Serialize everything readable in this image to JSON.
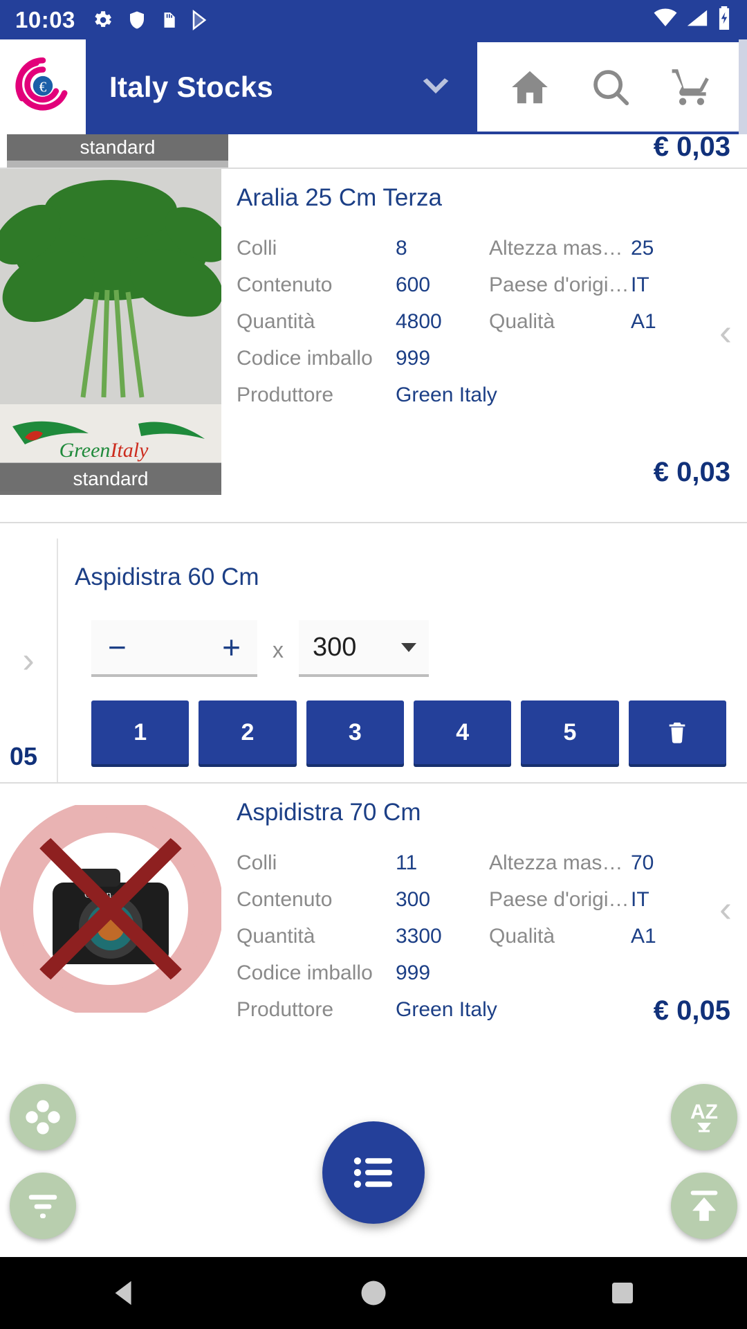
{
  "status_bar": {
    "time": "10:03",
    "left_icons": [
      "gear-icon",
      "shield-icon",
      "sd-card-icon",
      "play-store-icon"
    ],
    "right_icons": [
      "wifi-icon",
      "signal-icon",
      "battery-charging-icon"
    ]
  },
  "app_bar": {
    "logo": "company-rose-logo",
    "title": "Italy Stocks",
    "dropdown_icon": "chevron-down-icon",
    "actions": [
      {
        "name": "home-icon",
        "label": "Home"
      },
      {
        "name": "search-icon",
        "label": "Search"
      },
      {
        "name": "cart-icon",
        "label": "Cart"
      }
    ]
  },
  "colors": {
    "primary": "#24409a",
    "title_text": "#1c3f86",
    "price_text": "#11317a",
    "label_gray": "#8a8a8a",
    "fab_green": "#b8ceae",
    "badge_gray": "#5a5a5a"
  },
  "attribute_labels": {
    "colli": "Colli",
    "contenuto": "Contenuto",
    "quantita": "Quantità",
    "codice_imballo": "Codice imballo",
    "produttore": "Produttore",
    "altezza": "Altezza massi…",
    "paese": "Paese d'origine",
    "qualita": "Qualità"
  },
  "clipped_card": {
    "badge": "standard",
    "price": "€ 0,03"
  },
  "products": [
    {
      "name": "Aralia 25 Cm Terza",
      "image": "aralia-plant-photo",
      "image_badge": "standard",
      "colli": "8",
      "contenuto": "600",
      "quantita": "4800",
      "codice_imballo": "999",
      "produttore": "Green Italy",
      "altezza": "25",
      "paese": "IT",
      "qualita": "A1",
      "price": "€ 0,03",
      "chevron": "chevron-left-icon"
    },
    {
      "name": "Aspidistra 70 Cm",
      "image": "no-photo-placeholder",
      "image_badge": "",
      "colli": "11",
      "contenuto": "300",
      "quantita": "3300",
      "codice_imballo": "999",
      "produttore": "Green Italy",
      "altezza": "70",
      "paese": "IT",
      "qualita": "A1",
      "price": "€ 0,05",
      "chevron": "chevron-left-icon"
    }
  ],
  "order_card": {
    "title": "Aspidistra 60 Cm",
    "badge": "05",
    "expand_icon": "chevron-right-icon",
    "stepper": {
      "minus": "−",
      "plus": "+"
    },
    "multiplier_label": "x",
    "pack_size": "300",
    "pack_caret": "caret-down-icon",
    "quick_buttons": [
      "1",
      "2",
      "3",
      "4",
      "5"
    ],
    "delete_button": "trash-icon"
  },
  "fabs": [
    {
      "name": "flower-fab",
      "icon": "flower-icon"
    },
    {
      "name": "filter-fab",
      "icon": "filter-icon"
    },
    {
      "name": "sort-az-fab",
      "icon": "sort-az-icon",
      "label": "AZ"
    },
    {
      "name": "scroll-top-fab",
      "icon": "upload-arrow-icon"
    },
    {
      "name": "list-menu-fab",
      "icon": "list-icon"
    }
  ],
  "nav_bar": {
    "back": "back-triangle-icon",
    "home": "home-circle-icon",
    "recents": "recents-square-icon"
  }
}
